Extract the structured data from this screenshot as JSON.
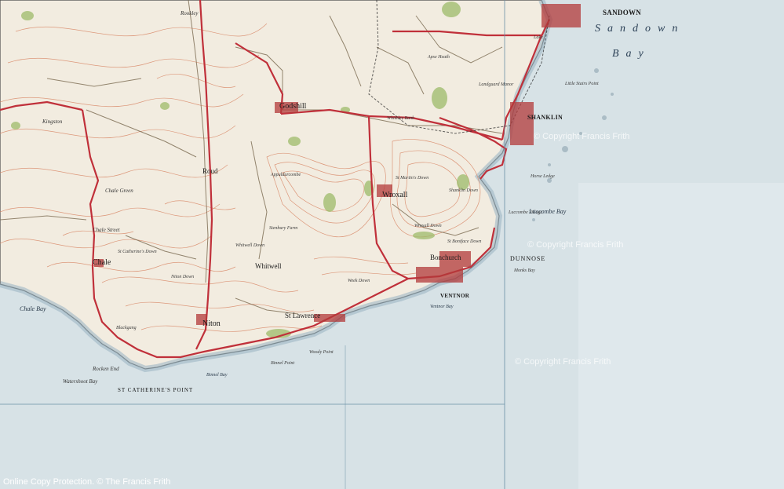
{
  "map": {
    "sea_labels": [
      "Sandown",
      "Bay"
    ],
    "bays": [
      "Chale Bay",
      "Luccombe Bay",
      "Ventnor Bay",
      "Binnel Bay"
    ],
    "towns": [
      "SANDOWN",
      "SHANKLIN",
      "VENTNOR",
      "Godshill",
      "Wroxall",
      "Bonchurch",
      "Whitwell",
      "Niton",
      "Chale",
      "St Lawrence"
    ],
    "villages": [
      "Kingston",
      "Chale Green",
      "Chale Street",
      "Rookley",
      "Roud",
      "Appuldurcombe",
      "Stenbury Farm",
      "Lake",
      "Apse Heath",
      "Landguard Manor",
      "Whiteley Bank",
      "Blackgang",
      "Rocken End",
      "Watershoot Bay",
      "St Catherine's Down",
      "Wroxall Down",
      "St Boniface Down",
      "Woody Point",
      "Binnel Point",
      "Week Down",
      "Shanklin Down",
      "St Martin's Down",
      "Niton Down",
      "Whitwell Down",
      "Luccombe Village",
      "Monks Bay"
    ],
    "points": [
      "DUNNOSE",
      "ST CATHERINE'S POINT",
      "Little Stairs Point",
      "Horse Ledge"
    ],
    "watermarks": [
      "© Copyright Francis Frith",
      "© Copyright Francis Frith",
      "© Copyright Francis Frith"
    ],
    "copyright_bar": "Online Copy Protection.  © The Francis Frith Collection",
    "colors": {
      "sea": "#d7e2e6",
      "land": "#f2ece0",
      "contour": "#d98a6a",
      "road_major": "#c0303a",
      "road_minor": "#7a6a50",
      "woodland": "#9dbb6a",
      "grid": "#6a90a6",
      "blank_panel": "#dfe8ec"
    }
  }
}
